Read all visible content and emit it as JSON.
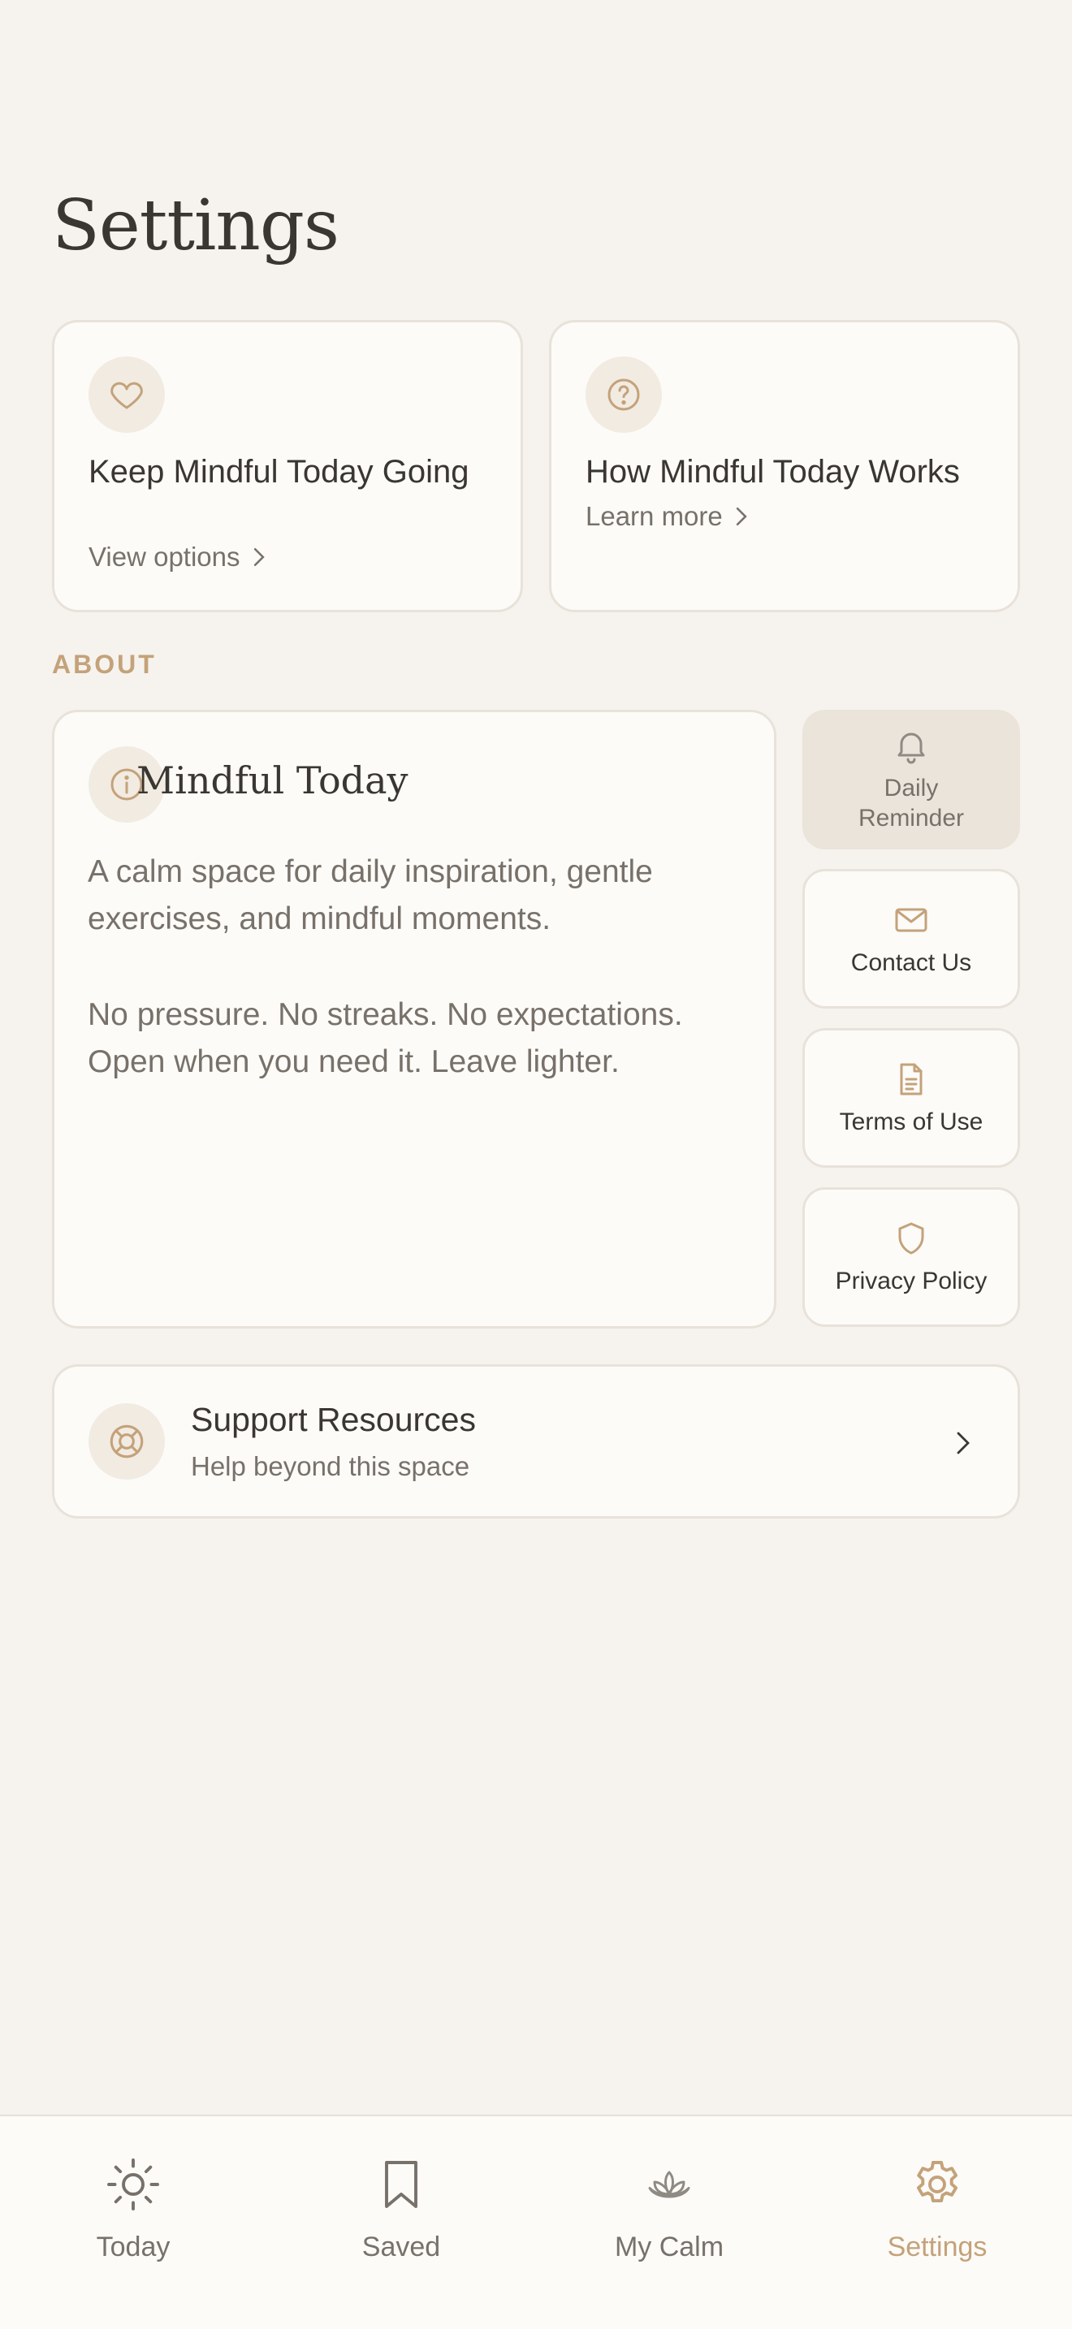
{
  "page": {
    "title": "Settings"
  },
  "top_cards": [
    {
      "title": "Keep Mindful Today Going",
      "link": "View options"
    },
    {
      "title": "How Mindful Today Works",
      "link": "Learn more"
    }
  ],
  "about": {
    "section_label": "ABOUT",
    "title": "Mindful Today",
    "paragraph1": "A calm space for daily inspiration, gentle exercises, and mindful moments.",
    "paragraph2": "No pressure. No streaks. No expectations. Open when you need it. Leave lighter."
  },
  "side_buttons": [
    {
      "label": "Daily Reminder",
      "icon": "bell-icon",
      "active": true
    },
    {
      "label": "Contact Us",
      "icon": "mail-icon",
      "active": false
    },
    {
      "label": "Terms of Use",
      "icon": "document-icon",
      "active": false
    },
    {
      "label": "Privacy Policy",
      "icon": "shield-icon",
      "active": false
    }
  ],
  "support": {
    "title": "Support Resources",
    "subtitle": "Help beyond this space"
  },
  "tabbar": {
    "tabs": [
      {
        "label": "Today",
        "icon": "sun-icon",
        "active": false
      },
      {
        "label": "Saved",
        "icon": "bookmark-icon",
        "active": false
      },
      {
        "label": "My Calm",
        "icon": "lotus-icon",
        "active": false
      },
      {
        "label": "Settings",
        "icon": "gear-icon",
        "active": true
      }
    ]
  },
  "colors": {
    "background": "#F6F3EE",
    "card": "#FCFBF8",
    "accent": "#C4A27A",
    "text": "#3A3631",
    "muted": "#77716A"
  }
}
